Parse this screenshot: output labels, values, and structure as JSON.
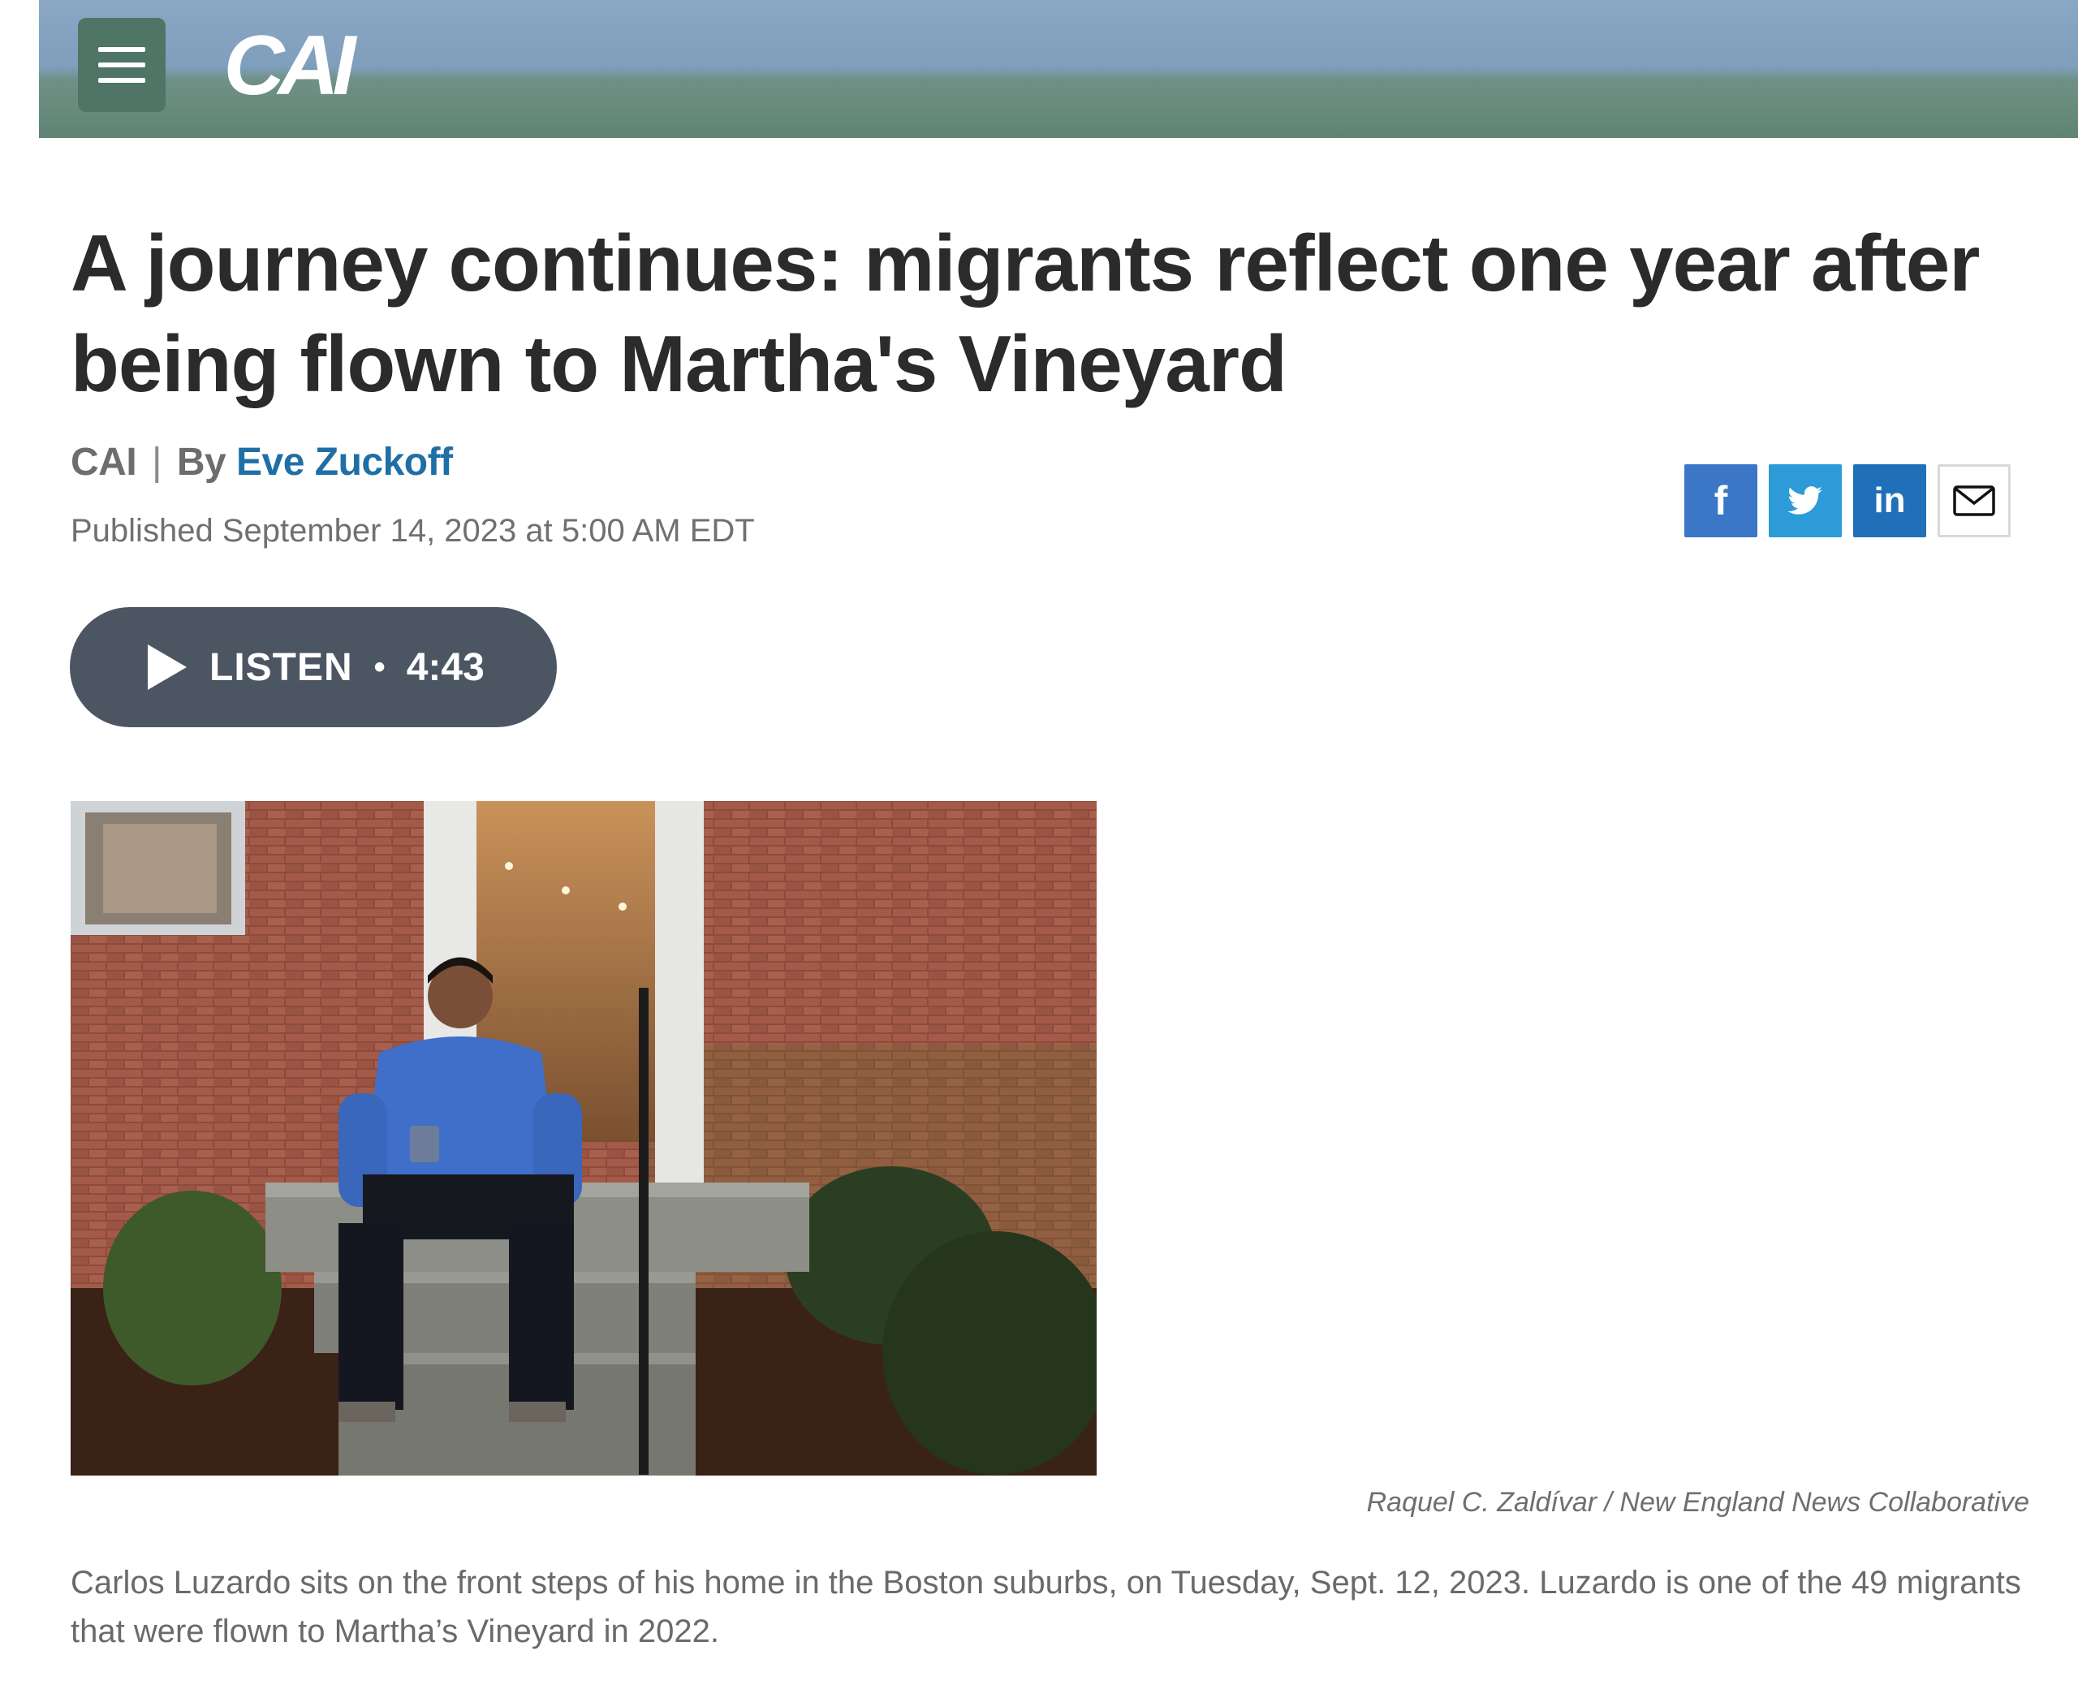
{
  "header": {
    "logo_text": "CAI",
    "menu_icon": "hamburger-menu-icon",
    "colors": {
      "sky": "#8aa7c4",
      "water": "#5f8474",
      "menu_bg": "#4f7566"
    }
  },
  "article": {
    "headline": "A journey continues: migrants reflect one year after being flown to Martha's Vineyard",
    "source": "CAI",
    "byline_prefix": "By",
    "author": "Eve Zuckoff",
    "published": "Published September 14, 2023 at 5:00 AM EDT"
  },
  "share": {
    "facebook": "f",
    "linkedin": "in",
    "icons": [
      "facebook-icon",
      "twitter-icon",
      "linkedin-icon",
      "email-icon"
    ],
    "colors": {
      "facebook": "#3b77c6",
      "twitter": "#2c9bd8",
      "linkedin": "#1f70b8"
    }
  },
  "audio": {
    "label": "LISTEN",
    "separator": "•",
    "duration": "4:43"
  },
  "photo": {
    "credit": "Raquel C. Zaldívar / New England News Collaborative",
    "caption": "Carlos Luzardo sits on the front steps of his home in the Boston suburbs, on Tuesday, Sept. 12, 2023. Luzardo is one of the 49 migrants that were flown to Martha’s Vineyard in 2022."
  }
}
